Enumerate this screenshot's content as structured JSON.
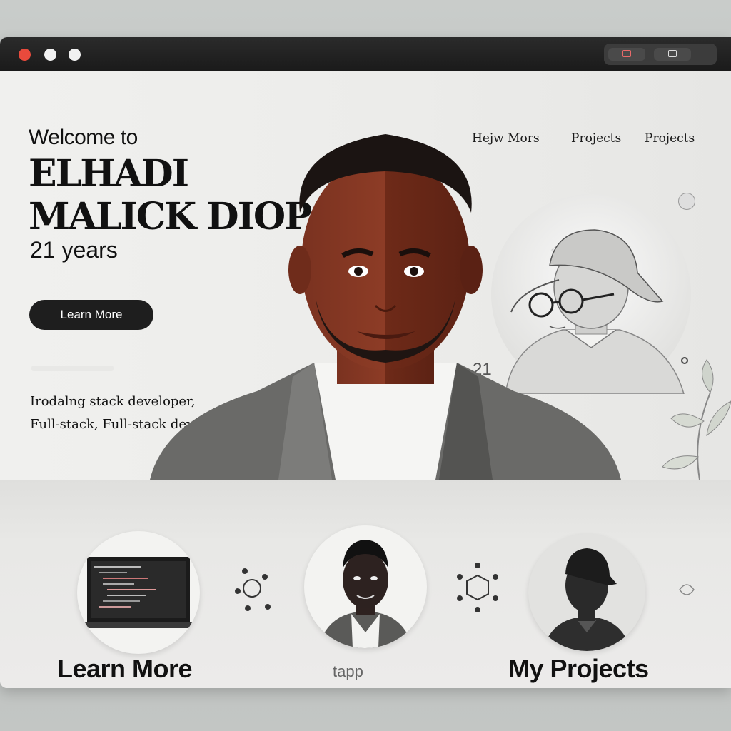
{
  "window": {
    "controls": [
      "close",
      "minimize",
      "maximize"
    ]
  },
  "hero": {
    "welcome": "Welcome to",
    "name_line1": "ELHADI",
    "name_line2": "MALICK DIOP",
    "age": "21 years",
    "cta_label": "Learn More",
    "tagline_line1": "Irodalng stack developer,",
    "tagline_line2": "Full-stack, Full-stack developer,",
    "side_number": "21"
  },
  "nav": {
    "items": [
      "Hejw Mors",
      "Projects",
      "Projects"
    ]
  },
  "features": {
    "learn_label": "Learn More",
    "middle_label": "tapp",
    "projects_label": "My Projects"
  },
  "colors": {
    "accent_dark": "#1e1e1e",
    "close_dot": "#e84a3c",
    "skin": "#8a3a22"
  },
  "icons": [
    "network-icon",
    "laptop-icon",
    "hexagon-network-icon",
    "plant-icon",
    "cloud-icon"
  ]
}
